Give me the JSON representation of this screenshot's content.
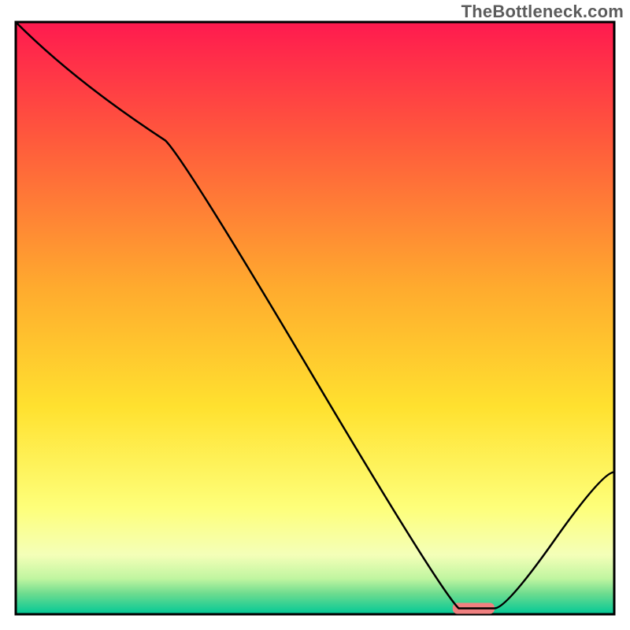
{
  "watermark": "TheBottleneck.com",
  "chart_data": {
    "type": "line",
    "title": "",
    "xlabel": "",
    "ylabel": "",
    "xlim": [
      0,
      100
    ],
    "ylim": [
      0,
      100
    ],
    "x": [
      0,
      25,
      74,
      80,
      100
    ],
    "values": [
      100,
      80,
      1,
      1,
      24
    ],
    "marker": {
      "x_start": 73,
      "x_end": 80,
      "y": 1,
      "color": "#f08080"
    },
    "axes_visible": false,
    "grid": false,
    "background_gradient": {
      "type": "vertical",
      "stops": [
        {
          "pos": 0.0,
          "color": "#ff1a4f"
        },
        {
          "pos": 0.2,
          "color": "#ff5a3c"
        },
        {
          "pos": 0.45,
          "color": "#ffab2e"
        },
        {
          "pos": 0.65,
          "color": "#ffe12f"
        },
        {
          "pos": 0.82,
          "color": "#feff7a"
        },
        {
          "pos": 0.9,
          "color": "#f4ffb8"
        },
        {
          "pos": 0.94,
          "color": "#c0f5a0"
        },
        {
          "pos": 0.965,
          "color": "#6edc8f"
        },
        {
          "pos": 1.0,
          "color": "#00c896"
        }
      ]
    },
    "border": {
      "visible": true,
      "color": "#000000",
      "width": 3
    }
  }
}
